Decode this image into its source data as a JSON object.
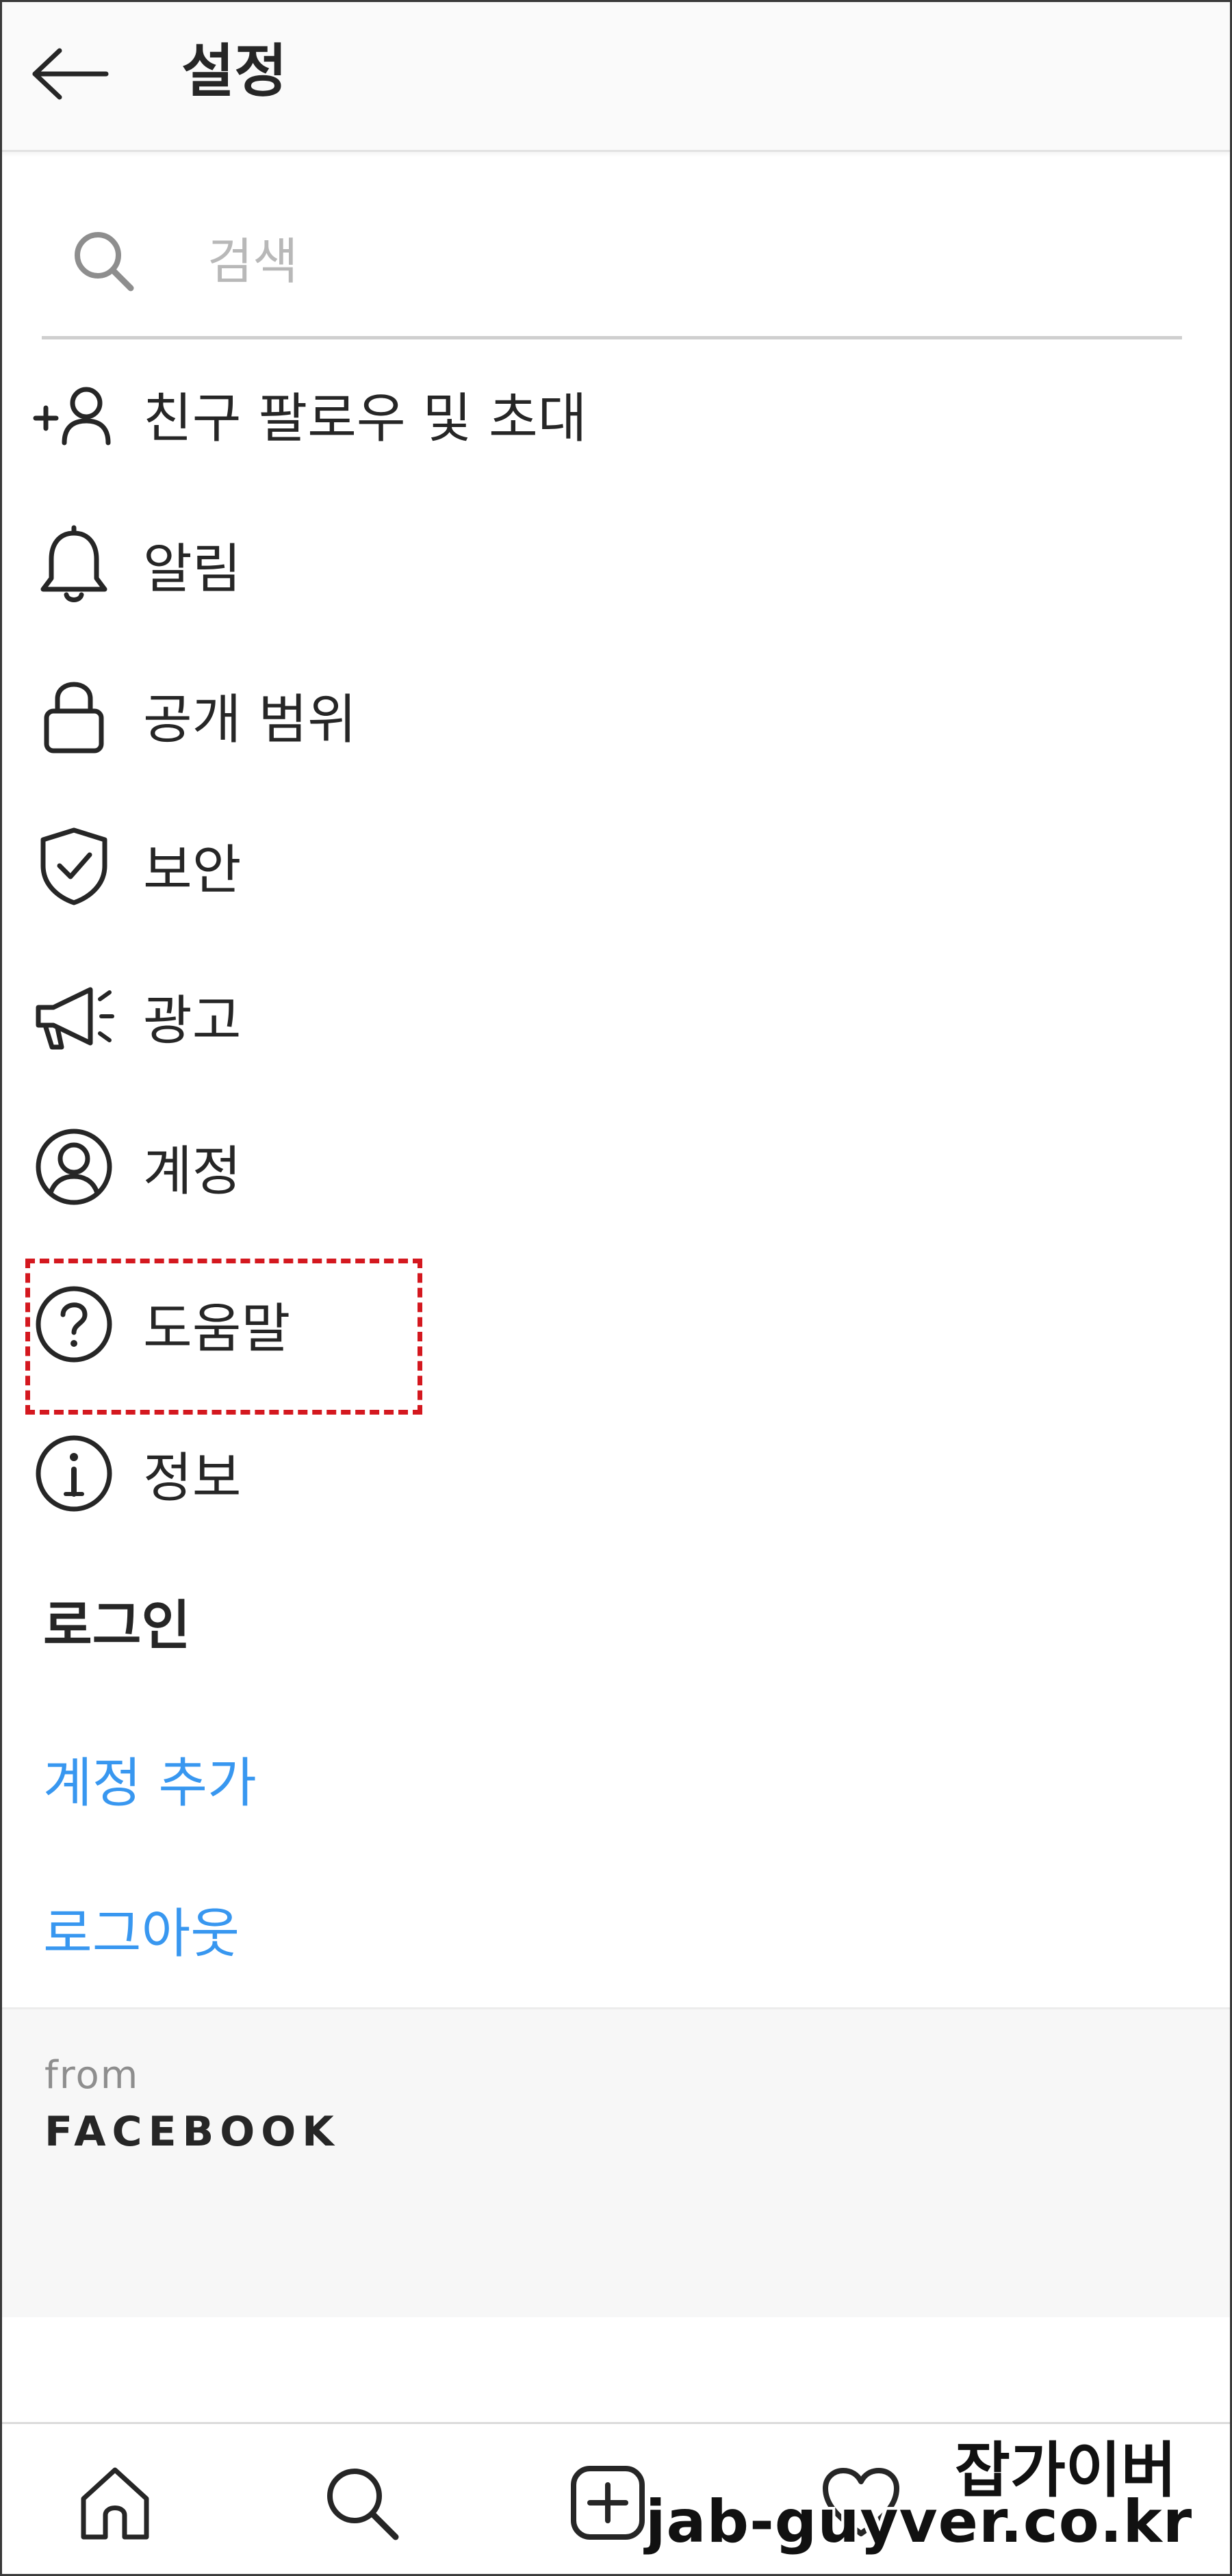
{
  "header": {
    "title": "설정",
    "back_icon": "arrow-left-icon"
  },
  "search": {
    "placeholder": "검색",
    "value": "",
    "icon": "search-icon"
  },
  "menu": {
    "items": [
      {
        "label": "친구 팔로우 및 초대",
        "icon": "add-person-icon"
      },
      {
        "label": "알림",
        "icon": "bell-icon"
      },
      {
        "label": "공개 범위",
        "icon": "lock-icon"
      },
      {
        "label": "보안",
        "icon": "shield-check-icon"
      },
      {
        "label": "광고",
        "icon": "megaphone-icon"
      },
      {
        "label": "계정",
        "icon": "account-circle-icon"
      },
      {
        "label": "도움말",
        "icon": "help-question-icon"
      },
      {
        "label": "정보",
        "icon": "info-icon"
      }
    ]
  },
  "login_section": {
    "title": "로그인",
    "add_account_label": "계정 추가",
    "logout_label": "로그아웃"
  },
  "footer": {
    "from_label": "from",
    "brand_label": "FACEBOOK"
  },
  "bottom_nav": {
    "items": [
      "home-icon",
      "search-icon",
      "plus-square-icon",
      "heart-icon"
    ]
  },
  "watermark": {
    "korean": "잡가이버",
    "url": "jab-guyver.co.kr"
  },
  "colors": {
    "link": "#3897f0",
    "text": "#262626",
    "highlight": "#d4181f",
    "header_bg": "#fafafa"
  }
}
